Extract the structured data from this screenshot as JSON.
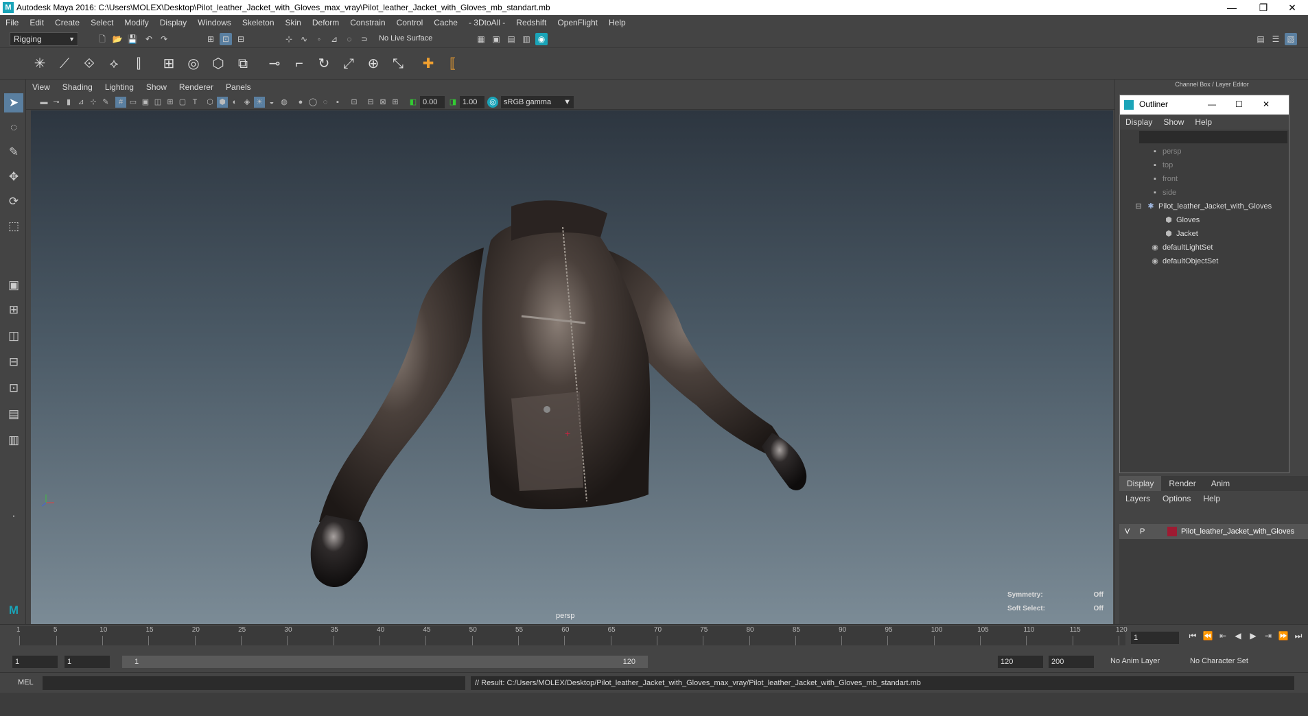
{
  "app": {
    "title": "Autodesk Maya 2016: C:\\Users\\MOLEX\\Desktop\\Pilot_leather_Jacket_with_Gloves_max_vray\\Pilot_leather_Jacket_with_Gloves_mb_standart.mb",
    "window_controls": [
      "—",
      "❐",
      "✕"
    ]
  },
  "menubar": [
    "File",
    "Edit",
    "Create",
    "Select",
    "Modify",
    "Display",
    "Windows",
    "Skeleton",
    "Skin",
    "Deform",
    "Constrain",
    "Control",
    "Cache",
    "- 3DtoAll -",
    "Redshift",
    "OpenFlight",
    "Help"
  ],
  "status_line": {
    "menuset": "Rigging",
    "live_surface": "No Live Surface"
  },
  "viewport": {
    "menu": [
      "View",
      "Shading",
      "Lighting",
      "Show",
      "Renderer",
      "Panels"
    ],
    "exposure": "0.00",
    "gamma": "1.00",
    "colorspace": "sRGB gamma",
    "camera_label": "persp",
    "symmetry_label": "Symmetry:",
    "symmetry_value": "Off",
    "soft_select_label": "Soft Select:",
    "soft_select_value": "Off"
  },
  "right_panel": {
    "title": "Channel Box / Layer Editor",
    "outliner": {
      "title": "Outliner",
      "menu": [
        "Display",
        "Show",
        "Help"
      ],
      "items": [
        {
          "label": "persp",
          "icon": "camera-icon",
          "type": "camera"
        },
        {
          "label": "top",
          "icon": "camera-icon",
          "type": "camera"
        },
        {
          "label": "front",
          "icon": "camera-icon",
          "type": "camera"
        },
        {
          "label": "side",
          "icon": "camera-icon",
          "type": "camera"
        },
        {
          "label": "Pilot_leather_Jacket_with_Gloves",
          "icon": "group-icon",
          "type": "group"
        },
        {
          "label": "Gloves",
          "icon": "mesh-icon",
          "type": "child"
        },
        {
          "label": "Jacket",
          "icon": "mesh-icon",
          "type": "child"
        },
        {
          "label": "defaultLightSet",
          "icon": "set-icon",
          "type": "set"
        },
        {
          "label": "defaultObjectSet",
          "icon": "set-icon",
          "type": "set"
        }
      ]
    },
    "layer_tabs": [
      "Display",
      "Render",
      "Anim"
    ],
    "layer_menu": [
      "Layers",
      "Options",
      "Help"
    ],
    "layer": {
      "v": "V",
      "p": "P",
      "name": "Pilot_leather_Jacket_with_Gloves",
      "color": "#9e1b32"
    }
  },
  "timeline": {
    "ticks": [
      "1",
      "5",
      "10",
      "15",
      "20",
      "25",
      "30",
      "35",
      "40",
      "45",
      "50",
      "55",
      "60",
      "65",
      "70",
      "75",
      "80",
      "85",
      "90",
      "95",
      "100",
      "105",
      "110",
      "115",
      "120"
    ],
    "current_frame": "1"
  },
  "range": {
    "start": "1",
    "playback_start": "1",
    "slider_start": "1",
    "slider_end": "120",
    "playback_end": "120",
    "end": "200",
    "anim_layer": "No Anim Layer",
    "character_set": "No Character Set"
  },
  "command": {
    "mode": "MEL",
    "result": "// Result: C:/Users/MOLEX/Desktop/Pilot_leather_Jacket_with_Gloves_max_vray/Pilot_leather_Jacket_with_Gloves_mb_standart.mb"
  }
}
